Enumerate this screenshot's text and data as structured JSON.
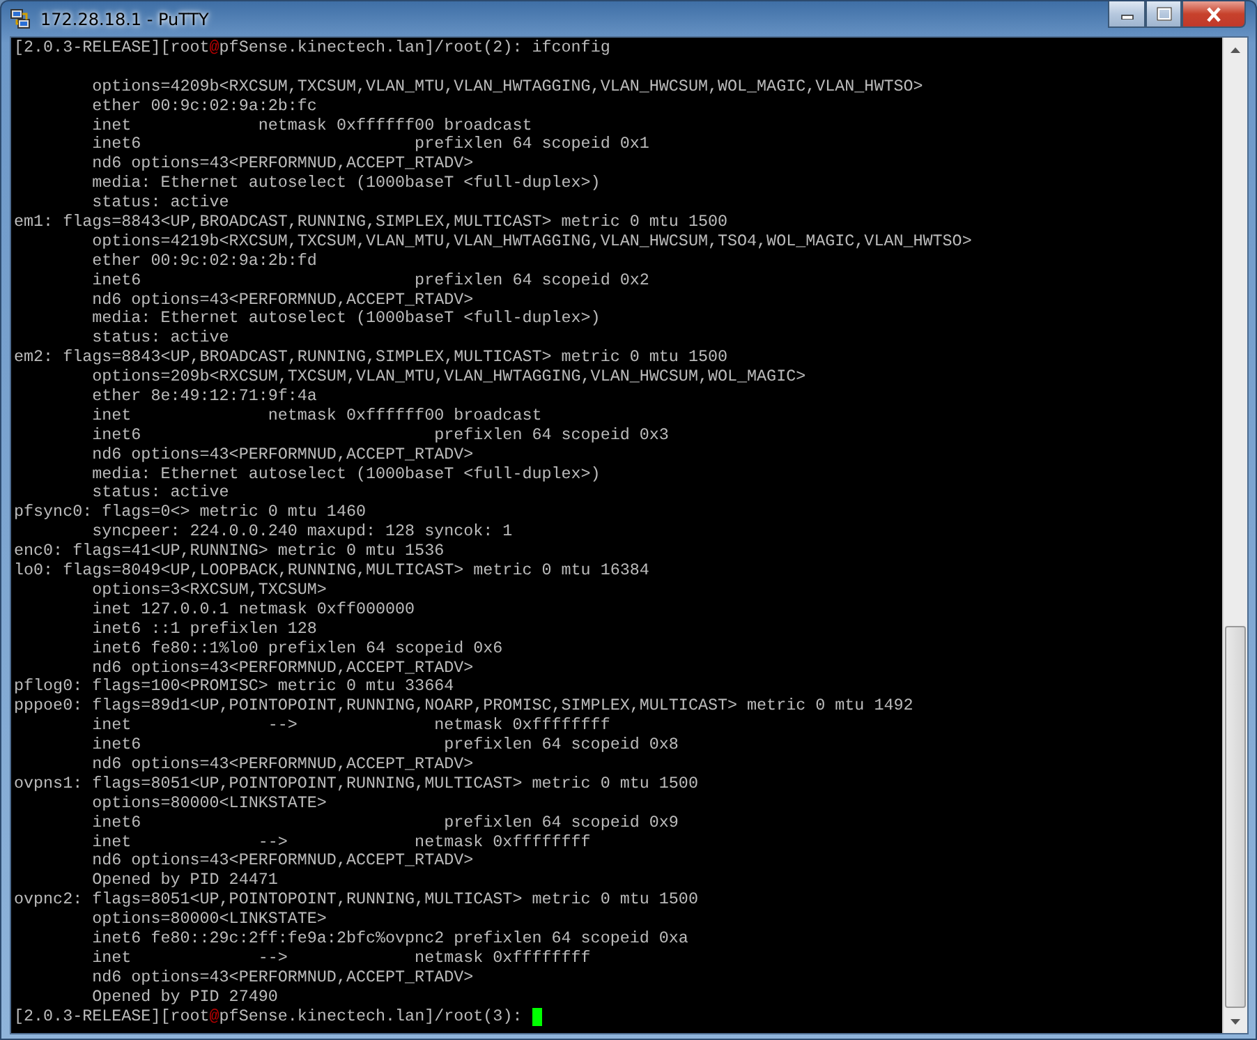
{
  "window": {
    "title": "172.28.18.1 - PuTTY"
  },
  "terminal": {
    "lines": [
      {
        "kind": "prompt",
        "user": "[2.0.3-RELEASE][root",
        "at": "@",
        "host": "pfSense.kinectech.lan]/root(2): ",
        "command": "ifconfig",
        "cursor": false
      },
      {
        "kind": "blank"
      },
      {
        "kind": "text",
        "text": "        options=4209b<RXCSUM,TXCSUM,VLAN_MTU,VLAN_HWTAGGING,VLAN_HWCSUM,WOL_MAGIC,VLAN_HWTSO>"
      },
      {
        "kind": "text",
        "text": "        ether 00:9c:02:9a:2b:fc"
      },
      {
        "kind": "text",
        "text": "        inet             netmask 0xffffff00 broadcast"
      },
      {
        "kind": "text",
        "text": "        inet6                            prefixlen 64 scopeid 0x1"
      },
      {
        "kind": "text",
        "text": "        nd6 options=43<PERFORMNUD,ACCEPT_RTADV>"
      },
      {
        "kind": "text",
        "text": "        media: Ethernet autoselect (1000baseT <full-duplex>)"
      },
      {
        "kind": "text",
        "text": "        status: active"
      },
      {
        "kind": "text",
        "text": "em1: flags=8843<UP,BROADCAST,RUNNING,SIMPLEX,MULTICAST> metric 0 mtu 1500"
      },
      {
        "kind": "text",
        "text": "        options=4219b<RXCSUM,TXCSUM,VLAN_MTU,VLAN_HWTAGGING,VLAN_HWCSUM,TSO4,WOL_MAGIC,VLAN_HWTSO>"
      },
      {
        "kind": "text",
        "text": "        ether 00:9c:02:9a:2b:fd"
      },
      {
        "kind": "text",
        "text": "        inet6                            prefixlen 64 scopeid 0x2"
      },
      {
        "kind": "text",
        "text": "        nd6 options=43<PERFORMNUD,ACCEPT_RTADV>"
      },
      {
        "kind": "text",
        "text": "        media: Ethernet autoselect (1000baseT <full-duplex>)"
      },
      {
        "kind": "text",
        "text": "        status: active"
      },
      {
        "kind": "text",
        "text": "em2: flags=8843<UP,BROADCAST,RUNNING,SIMPLEX,MULTICAST> metric 0 mtu 1500"
      },
      {
        "kind": "text",
        "text": "        options=209b<RXCSUM,TXCSUM,VLAN_MTU,VLAN_HWTAGGING,VLAN_HWCSUM,WOL_MAGIC>"
      },
      {
        "kind": "text",
        "text": "        ether 8e:49:12:71:9f:4a"
      },
      {
        "kind": "text",
        "text": "        inet              netmask 0xffffff00 broadcast"
      },
      {
        "kind": "text",
        "text": "        inet6                              prefixlen 64 scopeid 0x3"
      },
      {
        "kind": "text",
        "text": "        nd6 options=43<PERFORMNUD,ACCEPT_RTADV>"
      },
      {
        "kind": "text",
        "text": "        media: Ethernet autoselect (1000baseT <full-duplex>)"
      },
      {
        "kind": "text",
        "text": "        status: active"
      },
      {
        "kind": "text",
        "text": "pfsync0: flags=0<> metric 0 mtu 1460"
      },
      {
        "kind": "text",
        "text": "        syncpeer: 224.0.0.240 maxupd: 128 syncok: 1"
      },
      {
        "kind": "text",
        "text": "enc0: flags=41<UP,RUNNING> metric 0 mtu 1536"
      },
      {
        "kind": "text",
        "text": "lo0: flags=8049<UP,LOOPBACK,RUNNING,MULTICAST> metric 0 mtu 16384"
      },
      {
        "kind": "text",
        "text": "        options=3<RXCSUM,TXCSUM>"
      },
      {
        "kind": "text",
        "text": "        inet 127.0.0.1 netmask 0xff000000"
      },
      {
        "kind": "text",
        "text": "        inet6 ::1 prefixlen 128"
      },
      {
        "kind": "text",
        "text": "        inet6 fe80::1%lo0 prefixlen 64 scopeid 0x6"
      },
      {
        "kind": "text",
        "text": "        nd6 options=43<PERFORMNUD,ACCEPT_RTADV>"
      },
      {
        "kind": "text",
        "text": "pflog0: flags=100<PROMISC> metric 0 mtu 33664"
      },
      {
        "kind": "text",
        "text": "pppoe0: flags=89d1<UP,POINTOPOINT,RUNNING,NOARP,PROMISC,SIMPLEX,MULTICAST> metric 0 mtu 1492"
      },
      {
        "kind": "text",
        "text": "        inet              -->              netmask 0xffffffff"
      },
      {
        "kind": "text",
        "text": "        inet6                               prefixlen 64 scopeid 0x8"
      },
      {
        "kind": "text",
        "text": "        nd6 options=43<PERFORMNUD,ACCEPT_RTADV>"
      },
      {
        "kind": "text",
        "text": "ovpns1: flags=8051<UP,POINTOPOINT,RUNNING,MULTICAST> metric 0 mtu 1500"
      },
      {
        "kind": "text",
        "text": "        options=80000<LINKSTATE>"
      },
      {
        "kind": "text",
        "text": "        inet6                               prefixlen 64 scopeid 0x9"
      },
      {
        "kind": "text",
        "text": "        inet             -->             netmask 0xffffffff"
      },
      {
        "kind": "text",
        "text": "        nd6 options=43<PERFORMNUD,ACCEPT_RTADV>"
      },
      {
        "kind": "text",
        "text": "        Opened by PID 24471"
      },
      {
        "kind": "text",
        "text": "ovpnc2: flags=8051<UP,POINTOPOINT,RUNNING,MULTICAST> metric 0 mtu 1500"
      },
      {
        "kind": "text",
        "text": "        options=80000<LINKSTATE>"
      },
      {
        "kind": "text",
        "text": "        inet6 fe80::29c:2ff:fe9a:2bfc%ovpnc2 prefixlen 64 scopeid 0xa"
      },
      {
        "kind": "text",
        "text": "        inet             -->             netmask 0xffffffff"
      },
      {
        "kind": "text",
        "text": "        nd6 options=43<PERFORMNUD,ACCEPT_RTADV>"
      },
      {
        "kind": "text",
        "text": "        Opened by PID 27490"
      },
      {
        "kind": "prompt",
        "user": "[2.0.3-RELEASE][root",
        "at": "@",
        "host": "pfSense.kinectech.lan]/root(3): ",
        "cursor": true
      }
    ]
  }
}
